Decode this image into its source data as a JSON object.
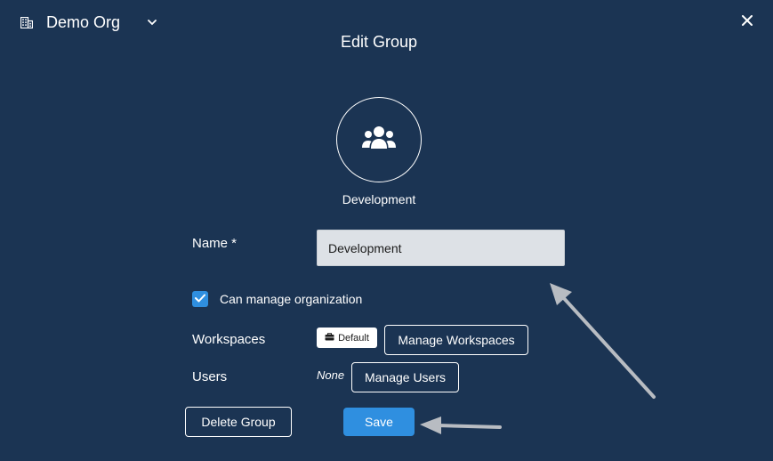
{
  "header": {
    "org_name": "Demo Org",
    "org_icon": "building-icon",
    "chevron_icon": "chevron-down-icon",
    "close_icon": "close-icon"
  },
  "dialog": {
    "title": "Edit Group"
  },
  "group": {
    "avatar_icon": "users-group-icon",
    "display_name": "Development"
  },
  "form": {
    "name_label": "Name *",
    "name_value": "Development",
    "can_manage_org_label": "Can manage organization",
    "can_manage_org_checked": true,
    "workspaces_label": "Workspaces",
    "default_badge_label": "Default",
    "default_badge_icon": "briefcase-icon",
    "manage_workspaces_label": "Manage Workspaces",
    "users_label": "Users",
    "users_value": "None",
    "manage_users_label": "Manage Users",
    "delete_group_label": "Delete Group",
    "save_label": "Save"
  },
  "colors": {
    "background": "#1b3453",
    "accent": "#2f8fe0",
    "input_bg": "#dde1e6",
    "annotation_arrow": "#b8bcc2"
  }
}
